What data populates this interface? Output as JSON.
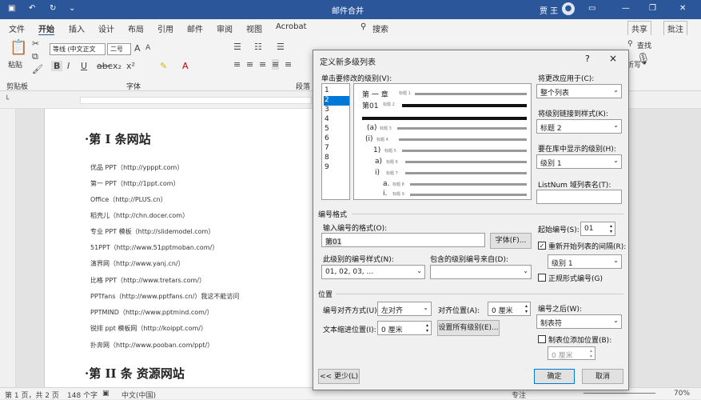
{
  "titlebar": {
    "doc_name": "邮件合并",
    "user": "贾 王",
    "avatar_icon": "user-icon"
  },
  "tabs": [
    "文件",
    "开始",
    "插入",
    "设计",
    "布局",
    "引用",
    "邮件",
    "审阅",
    "视图",
    "Acrobat",
    "搜索"
  ],
  "tab_right": {
    "share": "共享",
    "comment": "批注"
  },
  "ribbon": {
    "paste": "粘贴",
    "clipboard_group": "剪贴板",
    "font_name": "等线 (中文正文",
    "font_size": "二号",
    "font_group": "字体",
    "paragraph_group": "段落",
    "find": "查找",
    "listen": "听写"
  },
  "document": {
    "heading1": "·第 I 条网站",
    "lines": [
      "优品 PPT（http://ypppt.com）",
      "第一 PPT（http://1ppt.com）",
      "Office（http://PLUS.cn）",
      "稻壳儿（http://chn.docer.com）",
      "专业 PPT 模板（http://slidemodel.com）",
      "51PPT（http://www.51pptmoban.com/）",
      "演界网（http://www.yanj.cn/）",
      "比格 PPT（http://www.tretars.com/）",
      "PPTfans（http://www.pptfans.cn/）我这不能访问",
      "PPTMIND（http://www.pptmind.com/）",
      "锐排 ppt 模板网（http://koippt.com/）",
      "扑奔网（http://www.pooban.com/ppt/）"
    ],
    "heading2": "·第 II 条  资源网站"
  },
  "status": {
    "page": "第 1 页，共 2 页",
    "words": "148 个字",
    "language": "中文(中国)",
    "focus": "专注",
    "zoom": "70%"
  },
  "dialog": {
    "title": "定义新多级列表",
    "help": "?",
    "close": "×",
    "level_label": "单击要修改的级别(V):",
    "levels": [
      "1",
      "2",
      "3",
      "4",
      "5",
      "6",
      "7",
      "8",
      "9"
    ],
    "selected_level": "2",
    "preview": [
      {
        "text": "第 一 章",
        "tag": "标题 1"
      },
      {
        "text": "第01",
        "tag": "标题 2"
      },
      {
        "text": "(a)",
        "tag": "标题 3"
      },
      {
        "text": "(i)",
        "tag": "标题 4"
      },
      {
        "text": "1)",
        "tag": "标题 5"
      },
      {
        "text": "a)",
        "tag": "标题 6"
      },
      {
        "text": "i)",
        "tag": "标题 7"
      },
      {
        "text": "a.",
        "tag": "标题 8"
      },
      {
        "text": "i.",
        "tag": "标题 9"
      }
    ],
    "apply_to_label": "将更改应用于(C):",
    "apply_to_value": "整个列表",
    "link_style_label": "将级别链接到样式(K):",
    "link_style_value": "标题 2",
    "gallery_level_label": "要在库中显示的级别(H):",
    "gallery_level_value": "级别 1",
    "listnum_label": "ListNum 域列表名(T):",
    "listnum_value": "",
    "number_format_section": "编号格式",
    "enter_format_label": "输入编号的格式(O):",
    "enter_format_value": "第01",
    "font_button": "字体(F)...",
    "number_style_label": "此级别的编号样式(N):",
    "number_style_value": "01, 02, 03, ...",
    "include_level_label": "包含的级别编号来自(D):",
    "include_level_value": "",
    "start_at_label": "起始编号(S):",
    "start_at_value": "01",
    "restart_label": "重新开始列表的间隔(R):",
    "restart_checked": true,
    "restart_value": "级别 1",
    "legal_label": "正规形式编号(G)",
    "legal_checked": false,
    "position_section": "位置",
    "alignment_label": "编号对齐方式(U):",
    "alignment_value": "左对齐",
    "aligned_at_label": "对齐位置(A):",
    "aligned_at_value": "0 厘米",
    "follow_label": "编号之后(W):",
    "follow_value": "制表符",
    "indent_label": "文本缩进位置(I):",
    "indent_value": "0 厘米",
    "set_all_button": "设置所有级别(E)...",
    "tab_stop_label": "制表位添加位置(B):",
    "tab_stop_checked": false,
    "tab_stop_value": "0 厘米",
    "less_button": "<< 更少(L)",
    "ok_button": "确定",
    "cancel_button": "取消"
  }
}
